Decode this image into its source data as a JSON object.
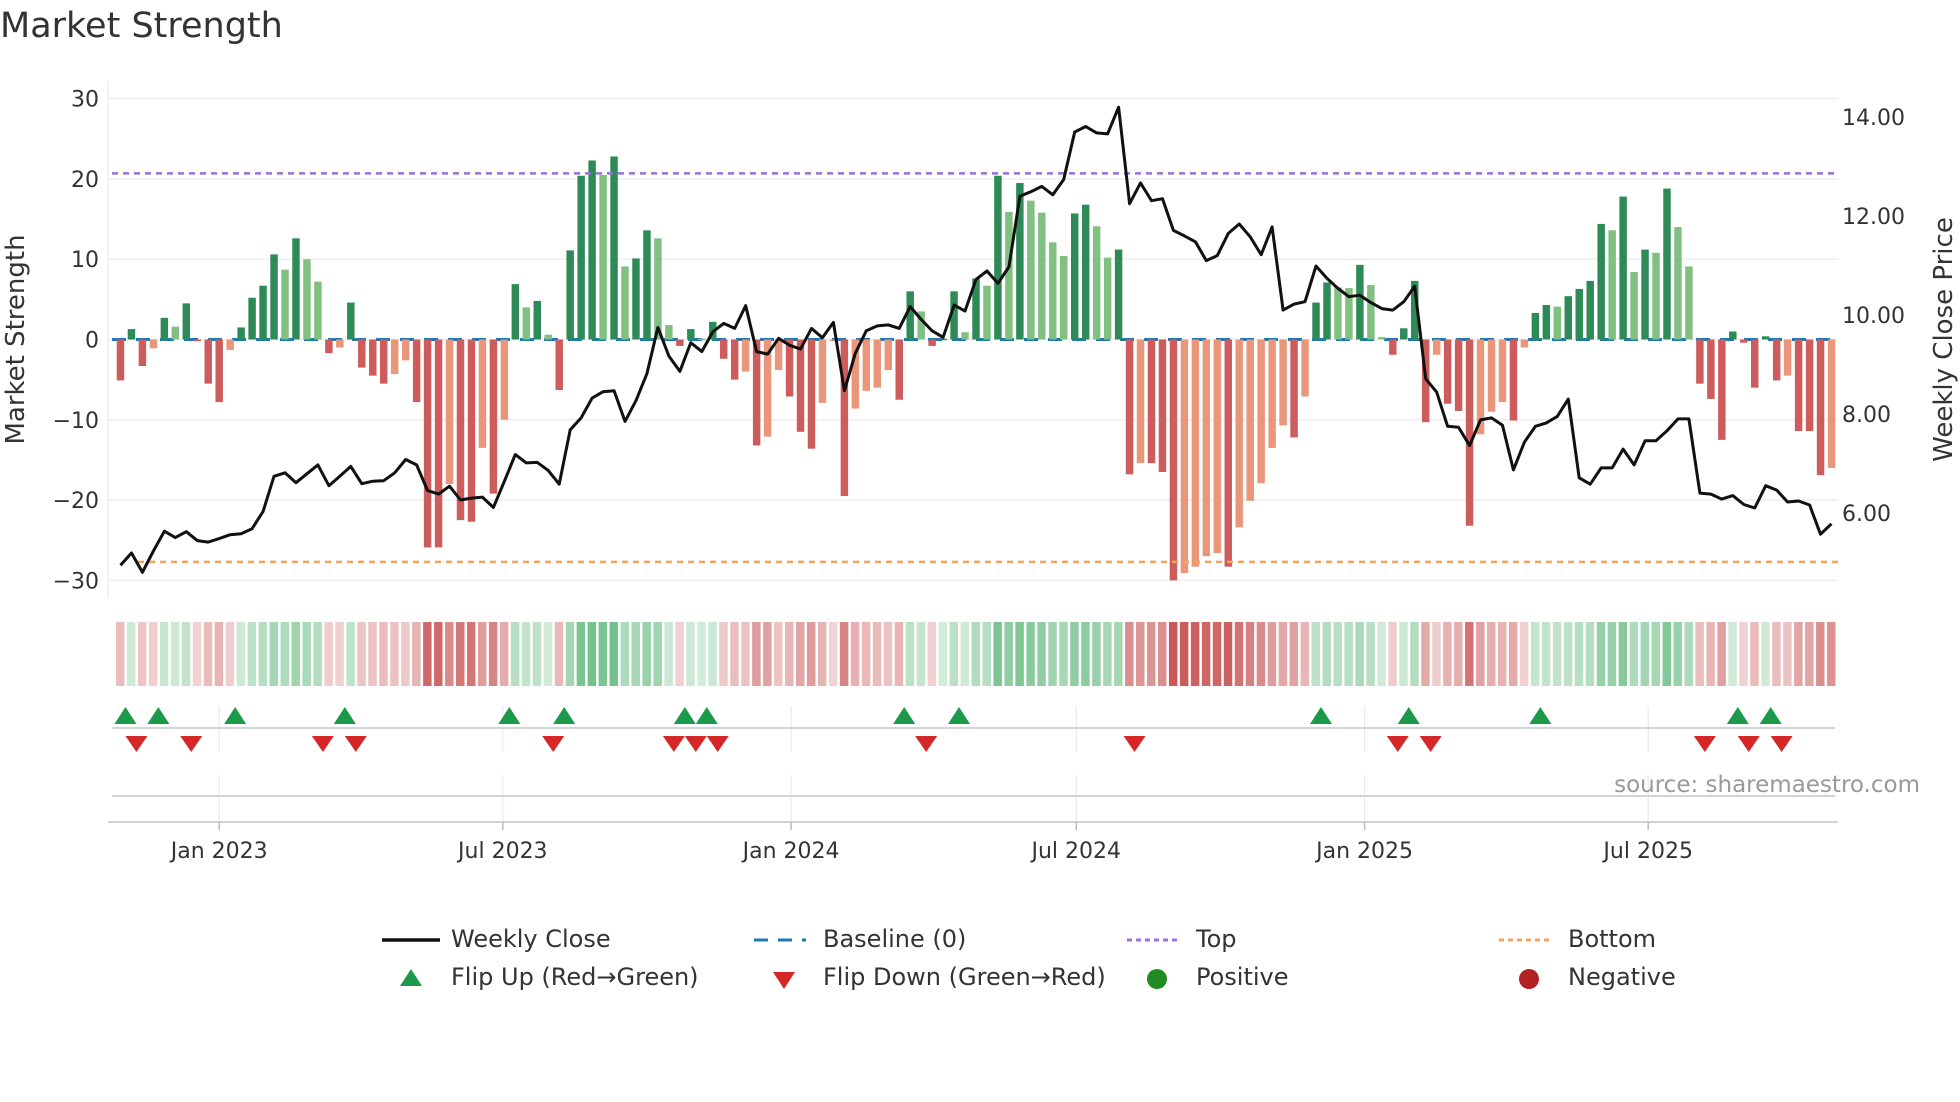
{
  "title": "Market Strength",
  "source": "source: sharemaestro.com",
  "chart_data": {
    "type": "bar",
    "title": "Market Strength",
    "frequency": "weekly",
    "start_date": "2022-10-30",
    "ylabel": "Market Strength",
    "y2label": "Weekly Close Price",
    "ylim": [
      -32.2,
      32.2
    ],
    "y2lim": [
      4.28,
      14.73
    ],
    "yticks": [
      30,
      20,
      10,
      0,
      -10,
      -20,
      -30
    ],
    "ytick_labels": [
      "30",
      "20",
      "10",
      "0",
      "−10",
      "−20",
      "−30"
    ],
    "y2ticks": [
      14,
      12,
      10,
      8,
      6
    ],
    "y2tick_labels": [
      "14.00",
      "12.00",
      "10.00",
      "8.00",
      "6.00"
    ],
    "xticks": [
      "2023-01-01",
      "2023-07-01",
      "2024-01-01",
      "2024-07-01",
      "2025-01-01",
      "2025-07-01"
    ],
    "xtick_labels": [
      "Jan 2023",
      "Jul 2023",
      "Jan 2024",
      "Jul 2024",
      "Jan 2025",
      "Jul 2025"
    ],
    "top_level": 20.7,
    "bottom_level": -27.7,
    "baseline": 0,
    "grid": true,
    "strength": [
      -5.1,
      1.3,
      -3.3,
      -1.1,
      2.7,
      1.6,
      4.5,
      -0.2,
      -5.5,
      -7.8,
      -1.3,
      1.5,
      5.2,
      6.7,
      10.6,
      8.7,
      12.6,
      10.0,
      7.2,
      -1.7,
      -1.0,
      4.6,
      -3.5,
      -4.5,
      -5.5,
      -4.3,
      -2.6,
      -7.8,
      -25.9,
      -25.9,
      -18.0,
      -22.5,
      -22.7,
      -13.5,
      -19.2,
      -10.0,
      6.9,
      4.0,
      4.8,
      0.6,
      -6.3,
      11.1,
      20.4,
      22.3,
      20.5,
      22.8,
      9.1,
      10.1,
      13.6,
      12.6,
      1.8,
      -0.8,
      1.3,
      0.1,
      2.2,
      -2.4,
      -5.0,
      -4.0,
      -13.2,
      -12.1,
      -3.8,
      -7.1,
      -11.5,
      -13.6,
      -7.9,
      -0.1,
      -19.5,
      -8.6,
      -6.4,
      -6.0,
      -3.8,
      -7.5,
      6.0,
      3.5,
      -0.8,
      0.1,
      6.0,
      0.9,
      7.6,
      6.7,
      20.4,
      15.9,
      19.5,
      17.3,
      15.8,
      12.1,
      10.4,
      15.7,
      16.8,
      14.1,
      10.2,
      11.2,
      -16.8,
      -15.4,
      -15.4,
      -16.5,
      -30.0,
      -29.1,
      -28.3,
      -27.0,
      -26.6,
      -28.3,
      -23.4,
      -20.1,
      -17.9,
      -13.5,
      -10.7,
      -12.2,
      -7.1,
      4.6,
      7.1,
      6.5,
      6.4,
      9.3,
      6.8,
      0.3,
      -1.9,
      1.4,
      7.3,
      -10.3,
      -1.9,
      -8.0,
      -8.9,
      -23.2,
      -11.8,
      -9.0,
      -7.8,
      -10.1,
      -1.0,
      3.3,
      4.3,
      4.1,
      5.4,
      6.3,
      7.3,
      14.4,
      13.6,
      17.8,
      8.4,
      11.2,
      10.8,
      18.8,
      14.0,
      9.1,
      -5.5,
      -7.4,
      -12.5,
      1.0,
      -0.4,
      -6.0,
      0.4,
      -5.1,
      -4.5,
      -11.4,
      -11.4,
      -16.9,
      -16.0
    ],
    "weekly_close": [
      4.94,
      5.19,
      4.8,
      5.23,
      5.63,
      5.5,
      5.62,
      5.44,
      5.41,
      5.48,
      5.56,
      5.58,
      5.68,
      6.03,
      6.74,
      6.81,
      6.61,
      6.79,
      6.97,
      6.55,
      6.74,
      6.94,
      6.59,
      6.64,
      6.65,
      6.81,
      7.08,
      6.97,
      6.45,
      6.38,
      6.54,
      6.26,
      6.3,
      6.32,
      6.11,
      6.64,
      7.18,
      7.01,
      7.02,
      6.86,
      6.58,
      7.68,
      7.92,
      8.32,
      8.45,
      8.47,
      7.85,
      8.27,
      8.82,
      9.75,
      9.17,
      8.86,
      9.44,
      9.26,
      9.66,
      9.83,
      9.73,
      10.19,
      9.26,
      9.21,
      9.53,
      9.39,
      9.31,
      9.73,
      9.54,
      9.85,
      8.47,
      9.23,
      9.68,
      9.78,
      9.8,
      9.73,
      10.17,
      9.91,
      9.68,
      9.55,
      10.2,
      10.08,
      10.72,
      10.89,
      10.64,
      10.97,
      12.4,
      12.49,
      12.6,
      12.43,
      12.74,
      13.7,
      13.81,
      13.68,
      13.66,
      14.2,
      12.25,
      12.67,
      12.31,
      12.35,
      11.71,
      11.6,
      11.48,
      11.1,
      11.2,
      11.65,
      11.84,
      11.58,
      11.22,
      11.78,
      10.1,
      10.22,
      10.27,
      10.99,
      10.74,
      10.54,
      10.37,
      10.4,
      10.25,
      10.13,
      10.1,
      10.27,
      10.58,
      8.71,
      8.44,
      7.75,
      7.73,
      7.36,
      7.88,
      7.92,
      7.77,
      6.87,
      7.43,
      7.75,
      7.82,
      7.95,
      8.3,
      6.71,
      6.58,
      6.91,
      6.91,
      7.29,
      6.97,
      7.46,
      7.46,
      7.66,
      7.9,
      7.9,
      6.4,
      6.38,
      6.28,
      6.35,
      6.17,
      6.1,
      6.55,
      6.46,
      6.22,
      6.24,
      6.16,
      5.57,
      5.78
    ],
    "flip_up_weeks": [
      1,
      4,
      11,
      21,
      36,
      41,
      52,
      54,
      72,
      77,
      110,
      118,
      130,
      148,
      151
    ],
    "flip_down_weeks": [
      2,
      7,
      19,
      22,
      40,
      51,
      53,
      55,
      74,
      93,
      117,
      120,
      145,
      149,
      152
    ],
    "colors": {
      "positive_rising": "#2e8b57",
      "positive_falling": "#80c080",
      "negative_falling": "#cd5c5c",
      "negative_rising": "#e9967a",
      "line": "#111111",
      "baseline": "#1f77b4",
      "top": "#9370db",
      "bottom": "#f4a460",
      "flip_up": "#1a9a4a",
      "flip_down": "#d62728",
      "positive_dot": "#228b22",
      "negative_dot": "#b22222"
    },
    "legend": {
      "placement": "bottom",
      "items": [
        "Weekly Close",
        "Baseline (0)",
        "Top",
        "Bottom",
        "Flip Up (Red→Green)",
        "Flip Down (Green→Red)",
        "Positive",
        "Negative"
      ]
    }
  }
}
